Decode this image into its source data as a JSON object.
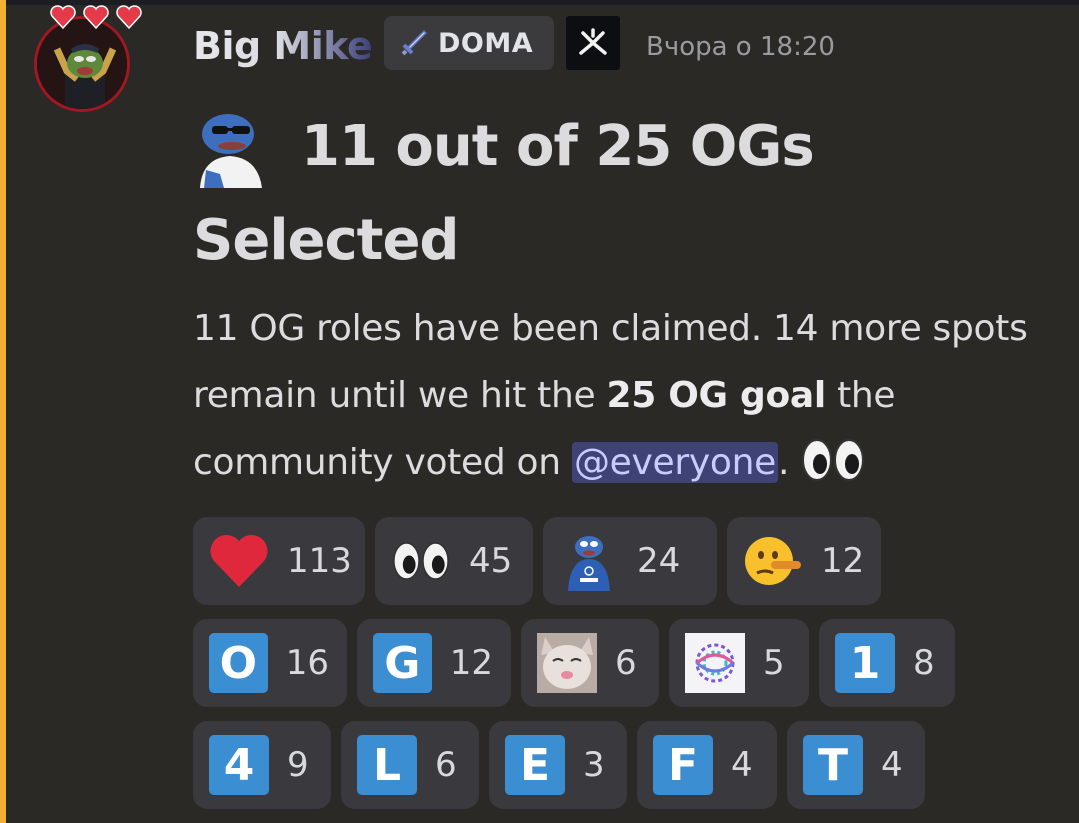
{
  "message": {
    "author": "Big Mike",
    "server_tag": "DOMA",
    "timestamp": "Вчора о 18:20",
    "heading": "11 out of 25 OGs Selected",
    "body": {
      "part1": "11 OG roles have been claimed. 14 more spots remain until we hit the ",
      "bold": "25 OG goal",
      "part2": " the community voted on ",
      "mention": "@everyone",
      "part3": ". "
    }
  },
  "reactions_row1": [
    {
      "emoji": "red-heart",
      "count": "113"
    },
    {
      "emoji": "eyes",
      "count": "45"
    },
    {
      "emoji": "pepe-doma",
      "count": "24"
    },
    {
      "emoji": "lying-face",
      "count": "12"
    }
  ],
  "reactions_row2": [
    {
      "letter": "O",
      "count": "16"
    },
    {
      "letter": "G",
      "count": "12"
    },
    {
      "emoji": "cat-face",
      "count": "6"
    },
    {
      "emoji": "doma-logo",
      "count": "5"
    },
    {
      "letter": "1",
      "count": "8"
    }
  ],
  "reactions_row3": [
    {
      "letter": "4",
      "count": "9"
    },
    {
      "letter": "L",
      "count": "6"
    },
    {
      "letter": "E",
      "count": "3"
    },
    {
      "letter": "F",
      "count": "4"
    },
    {
      "letter": "T",
      "count": "4"
    }
  ],
  "colors": {
    "background": "#2b2925",
    "mention_bar": "#f0b132",
    "reaction_bg": "#3a3a3e",
    "letter_tile": "#3b8ed1",
    "mention_bg": "#3e4275"
  }
}
